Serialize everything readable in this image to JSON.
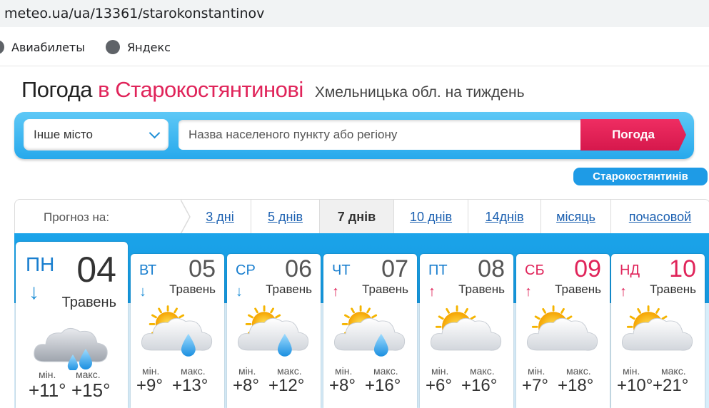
{
  "browser": {
    "url": "meteo.ua/ua/13361/starokonstantinov",
    "bookmarks": [
      {
        "label": "Авиабилеты",
        "icon": "globe-icon"
      },
      {
        "label": "Яндекс",
        "icon": "globe-icon"
      }
    ]
  },
  "header": {
    "title_prefix": "Погода",
    "title_city": "в Старокостянтинові",
    "title_region": "Хмельницька обл. на тиждень"
  },
  "search": {
    "select_label": "Інше місто",
    "placeholder": "Назва населеного пункту або регіону",
    "button": "Погода",
    "city_tag": "Старокостянтинів"
  },
  "tabs": {
    "label": "Прогноз на:",
    "items": [
      "3 дні",
      "5 днів",
      "7 днів",
      "10 днів",
      "14днів",
      "місяць",
      "почасовой"
    ],
    "active_index": 2
  },
  "forecast": {
    "min_label": "мін.",
    "max_label": "макс.",
    "days": [
      {
        "name": "ПН",
        "date": "04",
        "month": "Травень",
        "trend": "down",
        "icon": "cloud-rain-icon",
        "min": "+11°",
        "max": "+15°",
        "weekend": false
      },
      {
        "name": "ВТ",
        "date": "05",
        "month": "Травень",
        "trend": "down",
        "icon": "sun-cloud-rain-icon",
        "min": "+9°",
        "max": "+13°",
        "weekend": false
      },
      {
        "name": "СР",
        "date": "06",
        "month": "Травень",
        "trend": "down",
        "icon": "sun-cloud-rain-icon",
        "min": "+8°",
        "max": "+12°",
        "weekend": false
      },
      {
        "name": "ЧТ",
        "date": "07",
        "month": "Травень",
        "trend": "up",
        "icon": "sun-cloud-rain-icon",
        "min": "+8°",
        "max": "+16°",
        "weekend": false
      },
      {
        "name": "ПТ",
        "date": "08",
        "month": "Травень",
        "trend": "up",
        "icon": "sun-cloud-icon",
        "min": "+6°",
        "max": "+16°",
        "weekend": false
      },
      {
        "name": "СБ",
        "date": "09",
        "month": "Травень",
        "trend": "up",
        "icon": "sun-cloud-icon",
        "min": "+7°",
        "max": "+18°",
        "weekend": true
      },
      {
        "name": "НД",
        "date": "10",
        "month": "Травень",
        "trend": "up",
        "icon": "sun-cloud-icon",
        "min": "+10°",
        "max": "+21°",
        "weekend": true
      }
    ]
  },
  "colors": {
    "accent_blue": "#1ba4ea",
    "accent_red": "#e0245a"
  }
}
